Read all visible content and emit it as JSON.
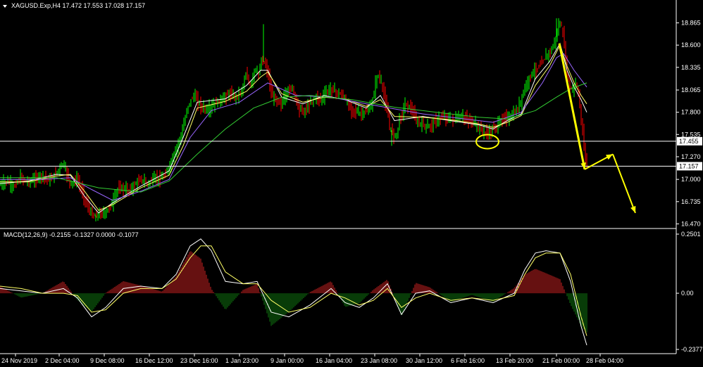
{
  "header": {
    "symbol_info": "XAGUSD.Exp,H4  17.472 17.553 17.028 17.157"
  },
  "macd_header": {
    "text": "MACD(12,26,9) -0.2155 -0.1327 0.0000 -0.1077"
  },
  "colors": {
    "background": "#000000",
    "bull_candle": "#00ff00",
    "bear_candle": "#ff0000",
    "ma_fast": "#ffffff",
    "ma_mid": "#ffff66",
    "ma_slow": "#9966ff",
    "ma_long": "#33cc33",
    "hline": "#ffffff",
    "arrow": "#ffff00",
    "macd_pos": "#cc2222",
    "macd_neg": "#117711",
    "macd_line": "#ffffff",
    "signal_line": "#ffff66"
  },
  "chart_data": [
    {
      "type": "candlestick",
      "title": "XAGUSD.Exp,H4",
      "yticks": [
        "18.865",
        "18.600",
        "18.335",
        "18.065",
        "17.800",
        "17.535",
        "17.270",
        "17.000",
        "16.735",
        "16.470"
      ],
      "ylim": [
        16.44,
        18.97
      ],
      "hlines": [
        {
          "value": 17.455,
          "label": "17.455"
        },
        {
          "value": 17.157,
          "label": "17.157"
        }
      ],
      "xticks": [
        "24 Nov 2019",
        "2 Dec 04:00",
        "9 Dec 08:00",
        "16 Dec 12:00",
        "23 Dec 16:00",
        "1 Jan 23:00",
        "9 Jan 00:00",
        "16 Jan 04:00",
        "23 Jan 08:00",
        "30 Jan 12:00",
        "6 Feb 16:00",
        "13 Feb 20:00",
        "21 Feb 00:00",
        "28 Feb 04:00"
      ],
      "price_path": {
        "x": [
          0,
          10,
          20,
          30,
          40,
          50,
          60,
          66,
          72,
          80,
          90,
          100,
          110,
          117,
          125,
          133,
          140,
          150,
          160,
          167,
          175,
          183,
          190,
          200,
          210,
          220,
          228,
          236,
          244,
          252,
          260,
          268,
          276,
          285,
          295,
          305,
          315,
          325,
          335,
          343,
          350,
          356,
          362,
          368,
          372,
          376,
          380,
          386,
          392,
          400,
          408,
          416,
          424,
          432,
          440,
          448,
          456,
          464,
          472,
          480,
          488,
          496,
          504,
          512,
          520,
          528,
          536,
          542,
          548,
          554,
          558,
          562,
          568,
          576,
          584,
          592,
          600,
          608,
          616,
          624,
          632,
          640,
          648,
          656,
          664,
          672,
          680,
          688,
          694,
          700,
          706,
          712,
          718,
          724,
          730,
          736,
          742,
          748,
          754,
          760,
          766,
          772,
          778,
          784,
          790,
          795,
          800,
          806,
          812,
          818,
          822,
          826,
          830,
          833
        ],
        "y": [
          16.93,
          16.98,
          16.91,
          17.02,
          16.97,
          17.0,
          17.05,
          17.01,
          16.99,
          17.08,
          17.2,
          16.95,
          17.0,
          16.85,
          16.67,
          16.56,
          16.58,
          16.6,
          16.72,
          16.88,
          16.9,
          16.86,
          16.92,
          17.0,
          16.95,
          17.02,
          17.0,
          17.06,
          17.22,
          17.4,
          17.6,
          17.9,
          18.0,
          17.88,
          17.82,
          17.9,
          17.95,
          18.02,
          17.98,
          18.05,
          18.25,
          18.1,
          18.32,
          18.25,
          18.42,
          18.38,
          18.3,
          18.0,
          17.95,
          17.9,
          18.05,
          18.1,
          17.85,
          17.8,
          17.9,
          17.98,
          17.95,
          18.05,
          18.08,
          18.02,
          18.0,
          17.85,
          17.82,
          17.78,
          17.8,
          17.88,
          18.25,
          18.15,
          17.9,
          17.62,
          17.55,
          17.5,
          17.72,
          17.9,
          17.85,
          17.68,
          17.66,
          17.62,
          17.68,
          17.72,
          17.75,
          17.7,
          17.72,
          17.75,
          17.71,
          17.68,
          17.62,
          17.56,
          17.54,
          17.6,
          17.64,
          17.7,
          17.75,
          17.72,
          17.78,
          17.85,
          18.0,
          18.15,
          18.25,
          18.3,
          18.35,
          18.42,
          18.5,
          18.55,
          18.7,
          18.88,
          18.72,
          18.2,
          18.05,
          18.15,
          18.0,
          17.65,
          17.4,
          17.157
        ]
      },
      "moving_averages": [
        {
          "color_key": "ma_fast",
          "x": [
            0,
            40,
            80,
            100,
            120,
            140,
            160,
            200,
            240,
            260,
            280,
            320,
            350,
            370,
            380,
            400,
            430,
            460,
            490,
            520,
            540,
            560,
            600,
            640,
            680,
            700,
            720,
            740,
            760,
            780,
            795,
            805,
            815,
            825,
            833
          ],
          "y": [
            16.95,
            16.98,
            17.06,
            17.05,
            16.8,
            16.6,
            16.72,
            16.92,
            17.1,
            17.5,
            17.92,
            17.96,
            18.12,
            18.3,
            18.3,
            17.98,
            17.9,
            18.0,
            17.95,
            17.85,
            18.0,
            17.7,
            17.75,
            17.7,
            17.65,
            17.6,
            17.7,
            17.78,
            18.2,
            18.4,
            18.62,
            18.3,
            18.1,
            17.95,
            17.8
          ]
        },
        {
          "color_key": "ma_mid",
          "x": [
            0,
            40,
            80,
            100,
            120,
            140,
            160,
            200,
            240,
            260,
            280,
            320,
            350,
            370,
            380,
            400,
            430,
            460,
            490,
            520,
            540,
            560,
            600,
            640,
            680,
            700,
            720,
            740,
            760,
            780,
            795,
            805,
            815,
            825,
            833
          ],
          "y": [
            16.97,
            16.97,
            17.04,
            17.06,
            16.86,
            16.63,
            16.7,
            16.9,
            17.05,
            17.4,
            17.85,
            17.93,
            18.05,
            18.22,
            18.28,
            18.02,
            17.92,
            17.98,
            17.96,
            17.87,
            17.95,
            17.75,
            17.74,
            17.71,
            17.66,
            17.62,
            17.68,
            17.76,
            18.12,
            18.35,
            18.6,
            18.35,
            18.15,
            18.0,
            17.9
          ]
        },
        {
          "color_key": "ma_slow",
          "x": [
            0,
            60,
            100,
            130,
            160,
            200,
            240,
            270,
            300,
            340,
            380,
            420,
            470,
            520,
            560,
            600,
            650,
            700,
            740,
            770,
            790,
            800,
            815,
            833
          ],
          "y": [
            17.0,
            17.0,
            17.02,
            16.88,
            16.75,
            16.86,
            17.0,
            17.5,
            17.82,
            17.92,
            18.15,
            18.0,
            17.98,
            17.9,
            17.84,
            17.78,
            17.73,
            17.68,
            17.8,
            18.15,
            18.45,
            18.5,
            18.3,
            18.1
          ]
        },
        {
          "color_key": "ma_long",
          "x": [
            0,
            80,
            140,
            200,
            240,
            280,
            320,
            360,
            400,
            440,
            500,
            560,
            620,
            680,
            720,
            760,
            790,
            810,
            833
          ],
          "y": [
            17.02,
            17.02,
            16.9,
            16.85,
            16.98,
            17.3,
            17.6,
            17.85,
            17.98,
            18.0,
            17.95,
            17.86,
            17.8,
            17.74,
            17.72,
            17.82,
            17.98,
            18.08,
            18.15
          ]
        }
      ],
      "annotations": [
        {
          "type": "ellipse",
          "color_key": "arrow",
          "x": 692,
          "y": 17.45
        },
        {
          "type": "arrow_path",
          "color_key": "arrow",
          "points": [
            [
              794,
              18.62
            ],
            [
              830,
              17.12
            ],
            [
              870,
              17.3
            ],
            [
              902,
              16.6
            ]
          ]
        }
      ]
    },
    {
      "type": "histogram_with_lines",
      "title": "MACD(12,26,9)",
      "yticks": [
        "0.2501",
        "0.00",
        "-0.2377"
      ],
      "ylim": [
        -0.2377,
        0.2501
      ],
      "macd_x": [
        0,
        30,
        60,
        90,
        110,
        130,
        150,
        175,
        200,
        230,
        250,
        270,
        285,
        300,
        320,
        345,
        365,
        385,
        410,
        440,
        470,
        490,
        510,
        530,
        550,
        570,
        590,
        610,
        640,
        670,
        700,
        730,
        745,
        760,
        775,
        795,
        810,
        825,
        833
      ],
      "macd_line": [
        0.02,
        0.01,
        0.0,
        0.02,
        -0.02,
        -0.1,
        -0.06,
        0.02,
        0.03,
        0.02,
        0.08,
        0.2,
        0.23,
        0.18,
        0.05,
        0.04,
        0.05,
        -0.08,
        -0.1,
        -0.05,
        0.02,
        -0.04,
        -0.06,
        -0.02,
        0.04,
        -0.09,
        0.0,
        0.01,
        -0.04,
        -0.02,
        -0.04,
        0.0,
        0.1,
        0.17,
        0.18,
        0.17,
        0.05,
        -0.14,
        -0.22
      ],
      "signal_line": [
        0.03,
        0.02,
        0.0,
        0.0,
        -0.01,
        -0.08,
        -0.07,
        0.0,
        0.02,
        0.02,
        0.06,
        0.15,
        0.2,
        0.2,
        0.09,
        0.04,
        0.04,
        -0.03,
        -0.08,
        -0.06,
        0.0,
        -0.02,
        -0.05,
        -0.03,
        0.02,
        -0.06,
        -0.02,
        0.0,
        -0.03,
        -0.02,
        -0.03,
        -0.01,
        0.08,
        0.15,
        0.17,
        0.17,
        0.08,
        -0.1,
        -0.18
      ],
      "histogram": [
        0.01,
        -0.01,
        0.0,
        0.02,
        -0.01,
        -0.02,
        0.01,
        0.02,
        0.01,
        0.0,
        0.02,
        0.05,
        0.03,
        -0.02,
        -0.04,
        0.0,
        0.01,
        -0.05,
        -0.02,
        0.01,
        0.02,
        -0.02,
        -0.01,
        0.01,
        0.02,
        -0.03,
        0.02,
        0.01,
        -0.01,
        0.0,
        -0.01,
        0.01,
        0.02,
        0.02,
        0.01,
        0.0,
        -0.03,
        -0.04,
        -0.04
      ]
    }
  ]
}
